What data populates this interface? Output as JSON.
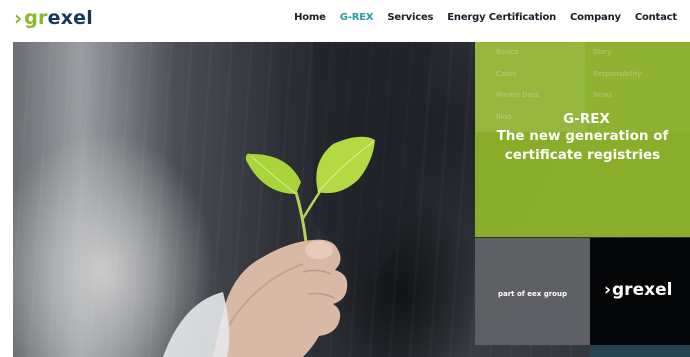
{
  "logo": {
    "chevron": "›",
    "part1": "gr",
    "part2": "exel"
  },
  "nav": {
    "items": [
      {
        "label": "Home",
        "active": false
      },
      {
        "label": "G-REX",
        "active": true
      },
      {
        "label": "Services",
        "active": false
      },
      {
        "label": "Energy Certification",
        "active": false
      },
      {
        "label": "Company",
        "active": false
      },
      {
        "label": "Contact",
        "active": false
      }
    ]
  },
  "submenu": {
    "grex": [
      "Basics",
      "Cases",
      "Market Data",
      "Blog"
    ],
    "company": [
      "Story",
      "Responsibility",
      "News"
    ]
  },
  "hero": {
    "title": "G-REX",
    "line1": "The new generation of",
    "line2": "certificate registries"
  },
  "footer_boxes": {
    "eex": "part of eex group",
    "logo_chevron": "›",
    "logo_word": "grexel"
  },
  "colors": {
    "brand_green": "#8ab82b",
    "brand_navy": "#17365f",
    "nav_active": "#2c9aa2"
  }
}
